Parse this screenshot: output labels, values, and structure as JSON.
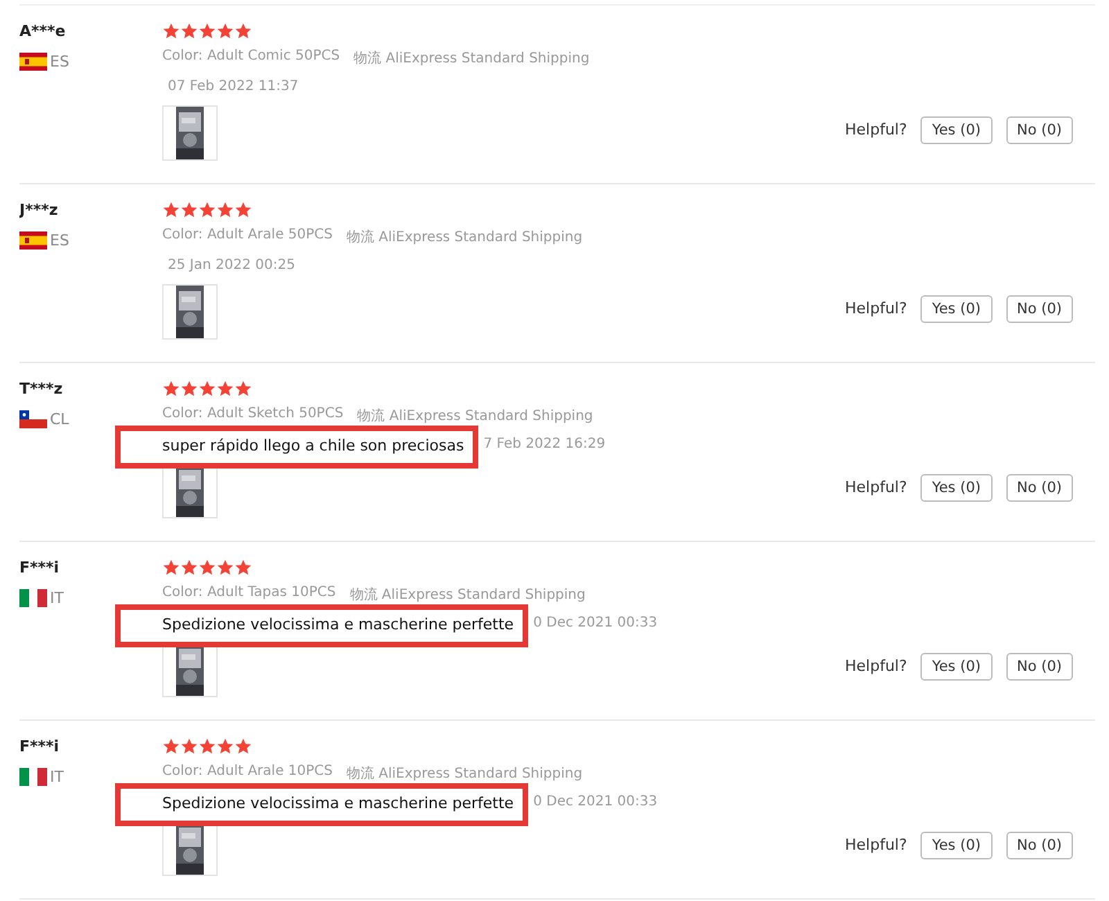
{
  "reviews": [
    {
      "name": "A***e",
      "flag": {
        "kind": "spain"
      },
      "country": "ES",
      "stars": 5,
      "variant": "Color: Adult Comic 50PCS",
      "shipping": "物流 AliExpress Standard Shipping",
      "date": "07 Feb 2022 11:37",
      "helpful": "Helpful?",
      "yes": "Yes (0)",
      "no": "No (0)"
    },
    {
      "name": "J***z",
      "flag": {
        "kind": "spain"
      },
      "country": "ES",
      "stars": 5,
      "variant": "Color: Adult Arale 50PCS",
      "shipping": "物流 AliExpress Standard Shipping",
      "date": "25 Jan 2022 00:25",
      "helpful": "Helpful?",
      "yes": "Yes (0)",
      "no": "No (0)"
    },
    {
      "name": "T***z",
      "flag": {
        "kind": "chile"
      },
      "country": "CL",
      "stars": 5,
      "variant": "Color: Adult Sketch 50PCS",
      "shipping": "物流 AliExpress Standard Shipping",
      "callout": "super rápido llego a chile son preciosas",
      "date": "7 Feb 2022 16:29",
      "helpful": "Helpful?",
      "yes": "Yes (0)",
      "no": "No (0)"
    },
    {
      "name": "F***i",
      "flag": {
        "kind": "italy"
      },
      "country": "IT",
      "stars": 5,
      "variant": "Color: Adult Tapas 10PCS",
      "shipping": "物流 AliExpress Standard Shipping",
      "callout": "Spedizione velocissima e mascherine perfette",
      "date": "0 Dec 2021 00:33",
      "helpful": "Helpful?",
      "yes": "Yes (0)",
      "no": "No (0)"
    },
    {
      "name": "F***i",
      "flag": {
        "kind": "italy"
      },
      "country": "IT",
      "stars": 5,
      "variant": "Color: Adult Arale 10PCS",
      "shipping": "物流 AliExpress Standard Shipping",
      "callout": "Spedizione velocissima e mascherine perfette",
      "date": "0 Dec 2021 00:33",
      "helpful": "Helpful?",
      "yes": "Yes (0)",
      "no": "No (0)"
    }
  ]
}
